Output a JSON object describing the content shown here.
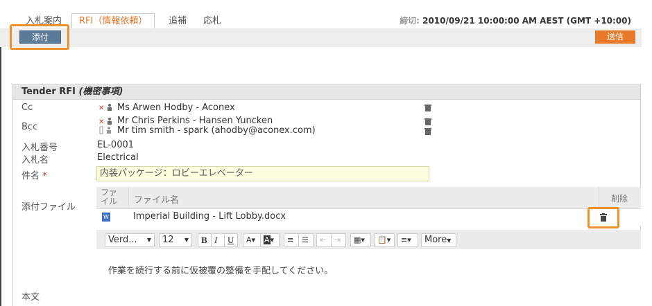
{
  "tabs": [
    {
      "label": "入札案内"
    },
    {
      "label": "RFI（情報依頼）"
    },
    {
      "label": "追補"
    },
    {
      "label": "応札"
    }
  ],
  "deadline": {
    "label": "締切:",
    "value": "2010/09/21 10:00:00 AM AEST (GMT +10:00)"
  },
  "toolbar": {
    "attach_label": "添付",
    "send_label": "送信"
  },
  "form": {
    "title": "Tender RFI",
    "title_suffix": "(機密事項)",
    "cc_label": "Cc",
    "cc": [
      "Ms Arwen Hodby - Aconex"
    ],
    "bcc_label": "Bcc",
    "bcc": [
      "Mr Chris Perkins - Hansen Yuncken",
      "Mr tim smith - spark (ahodby@aconex.com)"
    ],
    "tender_no_label": "入札番号",
    "tender_no": "EL-0001",
    "tender_name_label": "入札名",
    "tender_name": "Electrical",
    "subject_label": "件名",
    "required_mark": "*",
    "subject": "内装パッケージ：ロビーエレベーター",
    "attachments_label": "添付ファイル",
    "attachments_col_type": "ファイル",
    "attachments_col_name": "ファイル名",
    "attachments_col_delete": "削除",
    "attachments": [
      {
        "type_icon": "word-doc-icon",
        "name": "Imperial Building - Lift Lobby.docx"
      }
    ],
    "body_label": "本文"
  },
  "editor": {
    "font": "Verd...",
    "size": "12",
    "bold": "B",
    "italic": "I",
    "underline": "U",
    "more": "More",
    "body_text": "作業を続行する前に仮被覆の整備を手配してください。"
  },
  "colors": {
    "accent": "#e8782a",
    "attach_button": "#5b7a98",
    "highlight": "#f0902a"
  }
}
